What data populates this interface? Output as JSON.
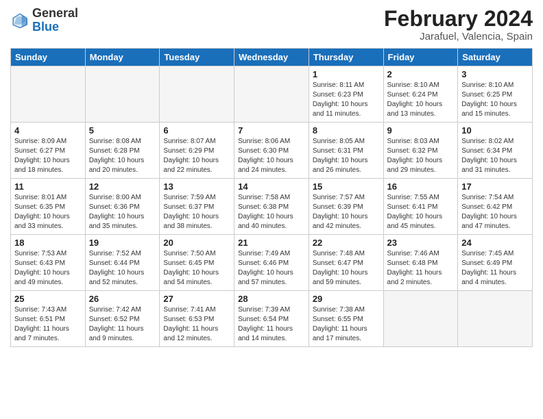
{
  "header": {
    "logo": {
      "general": "General",
      "blue": "Blue"
    },
    "title": "February 2024",
    "subtitle": "Jarafuel, Valencia, Spain"
  },
  "days_of_week": [
    "Sunday",
    "Monday",
    "Tuesday",
    "Wednesday",
    "Thursday",
    "Friday",
    "Saturday"
  ],
  "weeks": [
    [
      {
        "day": "",
        "empty": true
      },
      {
        "day": "",
        "empty": true
      },
      {
        "day": "",
        "empty": true
      },
      {
        "day": "",
        "empty": true
      },
      {
        "day": "1",
        "sunrise": "8:11 AM",
        "sunset": "6:23 PM",
        "daylight": "10 hours and 11 minutes."
      },
      {
        "day": "2",
        "sunrise": "8:10 AM",
        "sunset": "6:24 PM",
        "daylight": "10 hours and 13 minutes."
      },
      {
        "day": "3",
        "sunrise": "8:10 AM",
        "sunset": "6:25 PM",
        "daylight": "10 hours and 15 minutes."
      }
    ],
    [
      {
        "day": "4",
        "sunrise": "8:09 AM",
        "sunset": "6:27 PM",
        "daylight": "10 hours and 18 minutes."
      },
      {
        "day": "5",
        "sunrise": "8:08 AM",
        "sunset": "6:28 PM",
        "daylight": "10 hours and 20 minutes."
      },
      {
        "day": "6",
        "sunrise": "8:07 AM",
        "sunset": "6:29 PM",
        "daylight": "10 hours and 22 minutes."
      },
      {
        "day": "7",
        "sunrise": "8:06 AM",
        "sunset": "6:30 PM",
        "daylight": "10 hours and 24 minutes."
      },
      {
        "day": "8",
        "sunrise": "8:05 AM",
        "sunset": "6:31 PM",
        "daylight": "10 hours and 26 minutes."
      },
      {
        "day": "9",
        "sunrise": "8:03 AM",
        "sunset": "6:32 PM",
        "daylight": "10 hours and 29 minutes."
      },
      {
        "day": "10",
        "sunrise": "8:02 AM",
        "sunset": "6:34 PM",
        "daylight": "10 hours and 31 minutes."
      }
    ],
    [
      {
        "day": "11",
        "sunrise": "8:01 AM",
        "sunset": "6:35 PM",
        "daylight": "10 hours and 33 minutes."
      },
      {
        "day": "12",
        "sunrise": "8:00 AM",
        "sunset": "6:36 PM",
        "daylight": "10 hours and 35 minutes."
      },
      {
        "day": "13",
        "sunrise": "7:59 AM",
        "sunset": "6:37 PM",
        "daylight": "10 hours and 38 minutes."
      },
      {
        "day": "14",
        "sunrise": "7:58 AM",
        "sunset": "6:38 PM",
        "daylight": "10 hours and 40 minutes."
      },
      {
        "day": "15",
        "sunrise": "7:57 AM",
        "sunset": "6:39 PM",
        "daylight": "10 hours and 42 minutes."
      },
      {
        "day": "16",
        "sunrise": "7:55 AM",
        "sunset": "6:41 PM",
        "daylight": "10 hours and 45 minutes."
      },
      {
        "day": "17",
        "sunrise": "7:54 AM",
        "sunset": "6:42 PM",
        "daylight": "10 hours and 47 minutes."
      }
    ],
    [
      {
        "day": "18",
        "sunrise": "7:53 AM",
        "sunset": "6:43 PM",
        "daylight": "10 hours and 49 minutes."
      },
      {
        "day": "19",
        "sunrise": "7:52 AM",
        "sunset": "6:44 PM",
        "daylight": "10 hours and 52 minutes."
      },
      {
        "day": "20",
        "sunrise": "7:50 AM",
        "sunset": "6:45 PM",
        "daylight": "10 hours and 54 minutes."
      },
      {
        "day": "21",
        "sunrise": "7:49 AM",
        "sunset": "6:46 PM",
        "daylight": "10 hours and 57 minutes."
      },
      {
        "day": "22",
        "sunrise": "7:48 AM",
        "sunset": "6:47 PM",
        "daylight": "10 hours and 59 minutes."
      },
      {
        "day": "23",
        "sunrise": "7:46 AM",
        "sunset": "6:48 PM",
        "daylight": "11 hours and 2 minutes."
      },
      {
        "day": "24",
        "sunrise": "7:45 AM",
        "sunset": "6:49 PM",
        "daylight": "11 hours and 4 minutes."
      }
    ],
    [
      {
        "day": "25",
        "sunrise": "7:43 AM",
        "sunset": "6:51 PM",
        "daylight": "11 hours and 7 minutes."
      },
      {
        "day": "26",
        "sunrise": "7:42 AM",
        "sunset": "6:52 PM",
        "daylight": "11 hours and 9 minutes."
      },
      {
        "day": "27",
        "sunrise": "7:41 AM",
        "sunset": "6:53 PM",
        "daylight": "11 hours and 12 minutes."
      },
      {
        "day": "28",
        "sunrise": "7:39 AM",
        "sunset": "6:54 PM",
        "daylight": "11 hours and 14 minutes."
      },
      {
        "day": "29",
        "sunrise": "7:38 AM",
        "sunset": "6:55 PM",
        "daylight": "11 hours and 17 minutes."
      },
      {
        "day": "",
        "empty": true
      },
      {
        "day": "",
        "empty": true
      }
    ]
  ]
}
